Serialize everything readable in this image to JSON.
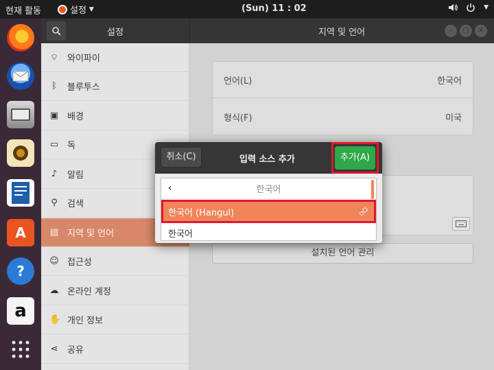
{
  "topbar": {
    "activities": "현재 활동",
    "app_menu": "설정",
    "clock": "(Sun) 11 : 02"
  },
  "dock": {
    "apps": [
      "firefox-icon",
      "thunderbird-icon",
      "files-icon",
      "rhythmbox-icon",
      "writer-icon",
      "software-icon",
      "help-icon",
      "amazon-icon",
      "show-apps-icon"
    ]
  },
  "window": {
    "sidebar_title": "설정",
    "main_title": "지역 및 언어",
    "sidebar_items": [
      {
        "label": "와이파이",
        "icon": "wifi-icon"
      },
      {
        "label": "블루투스",
        "icon": "bluetooth-icon"
      },
      {
        "label": "배경",
        "icon": "background-icon"
      },
      {
        "label": "독",
        "icon": "dock-icon"
      },
      {
        "label": "알림",
        "icon": "bell-icon"
      },
      {
        "label": "검색",
        "icon": "search-icon"
      },
      {
        "label": "지역 및 언어",
        "icon": "region-icon",
        "active": true
      },
      {
        "label": "접근성",
        "icon": "accessibility-icon"
      },
      {
        "label": "온라인 계정",
        "icon": "online-accounts-icon"
      },
      {
        "label": "개인 정보",
        "icon": "hand-icon"
      },
      {
        "label": "공유",
        "icon": "share-icon"
      }
    ],
    "language": {
      "label": "언어(L)",
      "value": "한국어"
    },
    "formats": {
      "label": "형식(F)",
      "value": "미국"
    },
    "manage_button": "설치된 언어 관리"
  },
  "dialog": {
    "cancel": "취소(C)",
    "title": "입력 소스 추가",
    "add": "추가(A)",
    "group_header": "한국어",
    "selected_item": "한국어 (Hangul)",
    "item": "한국어"
  },
  "colors": {
    "accent": "#e95420",
    "selected_row": "#f0845a",
    "add_button": "#2fa84a",
    "highlight_outline": "#e0182d"
  }
}
